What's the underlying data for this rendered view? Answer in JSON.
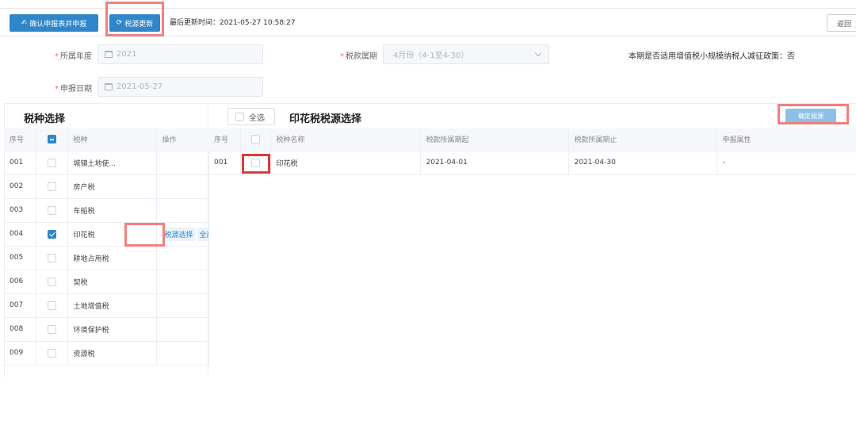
{
  "toolbar": {
    "confirm_label": "确认申报表并申报",
    "refresh_label": "税源更新",
    "update_time": "最后更新时间：2021-05-27 10:58:27",
    "back_label": "返回"
  },
  "form": {
    "year_label": "所属年度",
    "year_value": "2021",
    "period_label": "税款属期",
    "period_value": "4月份（4-1至4-30）",
    "date_label": "申报日期",
    "date_value": "2021-05-27",
    "policy_text": "本期是否适用增值税小规模纳税人减征政策：否"
  },
  "left_panel": {
    "title": "税种选择",
    "headers": [
      "序号",
      "",
      "税种",
      "操作"
    ],
    "rows": [
      {
        "no": "001",
        "name": "城镇土地使..."
      },
      {
        "no": "002",
        "name": "房产税"
      },
      {
        "no": "003",
        "name": "车船税"
      },
      {
        "no": "004",
        "name": "印花税",
        "op1": "税源选择",
        "op2": "全部"
      },
      {
        "no": "005",
        "name": "耕地占用税"
      },
      {
        "no": "006",
        "name": "契税"
      },
      {
        "no": "007",
        "name": "土地增值税"
      },
      {
        "no": "008",
        "name": "环境保护税"
      },
      {
        "no": "009",
        "name": "资源税"
      }
    ]
  },
  "right_panel": {
    "select_all_label": "全选",
    "title": "印花税税源选择",
    "confirm_source_label": "确定税源",
    "headers": [
      "序号",
      "",
      "税种名称",
      "税款所属期起",
      "税款所属期止",
      "申报属性"
    ],
    "rows": [
      {
        "no": "001",
        "name": "印花税",
        "start": "2021-04-01",
        "end": "2021-04-30",
        "attr": "-"
      }
    ]
  },
  "colors": {
    "primary": "#2f86c9",
    "highlight": "#f08080",
    "required": "#f56c6c"
  }
}
